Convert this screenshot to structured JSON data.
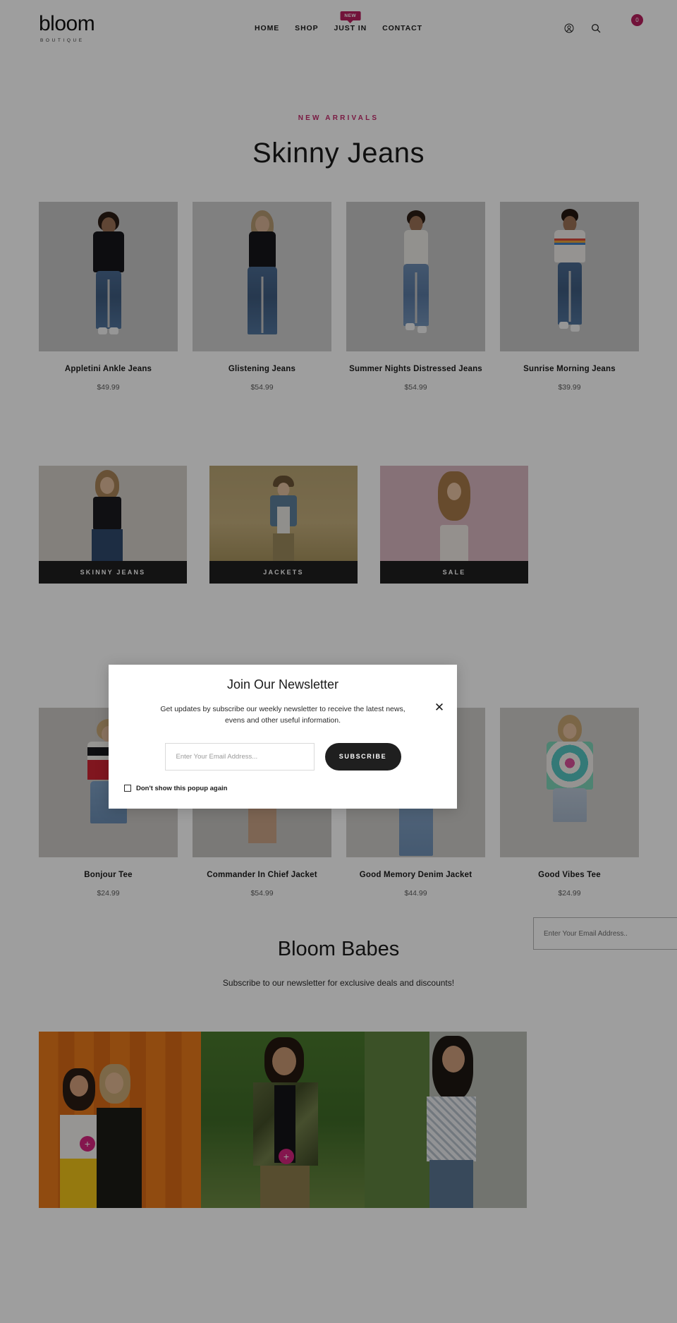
{
  "header": {
    "logo_main": "bloom",
    "logo_sub": "BOUTIQUE",
    "nav": [
      {
        "label": "HOME",
        "badge": null
      },
      {
        "label": "SHOP",
        "badge": null
      },
      {
        "label": "JUST IN",
        "badge": "NEW"
      },
      {
        "label": "CONTACT",
        "badge": null
      }
    ],
    "icons": {
      "account": "account-icon",
      "search": "search-icon",
      "cart": "cart-icon"
    },
    "cart_count": "0"
  },
  "hero": {
    "eyebrow": "NEW ARRIVALS",
    "title": "Skinny Jeans"
  },
  "products_top": [
    {
      "name": "Appletini Ankle Jeans",
      "price": "$49.99"
    },
    {
      "name": "Glistening Jeans",
      "price": "$54.99"
    },
    {
      "name": "Summer Nights Distressed Jeans",
      "price": "$54.99"
    },
    {
      "name": "Sunrise Morning Jeans",
      "price": "$39.99"
    }
  ],
  "categories": [
    {
      "label": "SKINNY JEANS"
    },
    {
      "label": "JACKETS"
    },
    {
      "label": "SALE"
    }
  ],
  "products_bottom": [
    {
      "name": "Bonjour Tee",
      "price": "$24.99"
    },
    {
      "name": "Commander In Chief Jacket",
      "price": "$54.99"
    },
    {
      "name": "Good Memory Denim Jacket",
      "price": "$44.99"
    },
    {
      "name": "Good Vibes Tee",
      "price": "$24.99"
    }
  ],
  "babes": {
    "title": "Bloom Babes",
    "subtitle": "Subscribe to our newsletter for exclusive deals and discounts!",
    "email_placeholder": "Enter Your Email Address.."
  },
  "gallery": {
    "hotspot_symbol": "+"
  },
  "modal": {
    "title": "Join Our Newsletter",
    "description": "Get updates by subscribe our weekly newsletter to receive the latest news, evens and other useful information.",
    "email_placeholder": "Enter Your Email Address...",
    "email_value": "",
    "subscribe_label": "SUBSCRIBE",
    "checkbox_label": "Don't show this popup again",
    "checkbox_checked": false,
    "close_symbol": "✕"
  },
  "colors": {
    "accent_pink": "#b8205e",
    "eyebrow_pink": "#c42a6b",
    "dark": "#1f1f1f",
    "hotspot": "#d6247e"
  }
}
